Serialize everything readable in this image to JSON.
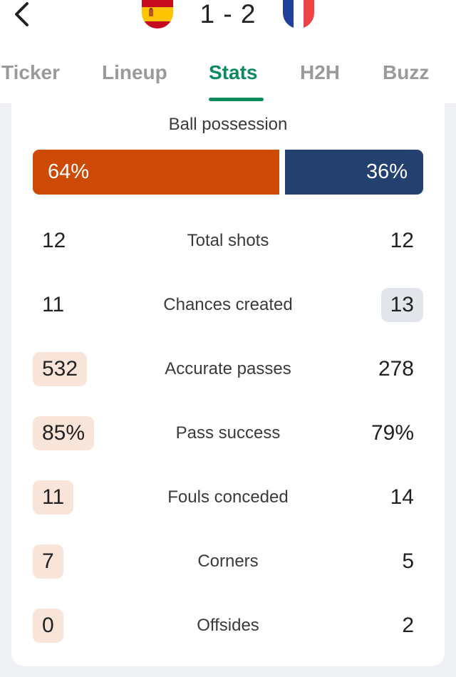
{
  "match": {
    "score": "1 - 2",
    "home_flag_icon": "spain-flag-icon",
    "away_flag_icon": "france-flag-icon"
  },
  "tabs": [
    {
      "label": "Ticker",
      "active": false
    },
    {
      "label": "Lineup",
      "active": false
    },
    {
      "label": "Stats",
      "active": true
    },
    {
      "label": "H2H",
      "active": false
    },
    {
      "label": "Buzz",
      "active": false
    }
  ],
  "possession": {
    "title": "Ball possession",
    "home": "64%",
    "away": "36%",
    "home_fraction": 0.64
  },
  "stats": [
    {
      "label": "Total shots",
      "home": "12",
      "away": "12",
      "highlight": "none"
    },
    {
      "label": "Chances created",
      "home": "11",
      "away": "13",
      "highlight": "away"
    },
    {
      "label": "Accurate passes",
      "home": "532",
      "away": "278",
      "highlight": "home"
    },
    {
      "label": "Pass success",
      "home": "85%",
      "away": "79%",
      "highlight": "home"
    },
    {
      "label": "Fouls conceded",
      "home": "11",
      "away": "14",
      "highlight": "home"
    },
    {
      "label": "Corners",
      "home": "7",
      "away": "5",
      "highlight": "home"
    },
    {
      "label": "Offsides",
      "home": "0",
      "away": "2",
      "highlight": "home"
    }
  ],
  "colors": {
    "accent": "#0b8a5c",
    "home_team": "#cc4a05",
    "away_team": "#23406e",
    "home_highlight": "#f9e4da",
    "away_highlight": "#e2e5ea"
  }
}
